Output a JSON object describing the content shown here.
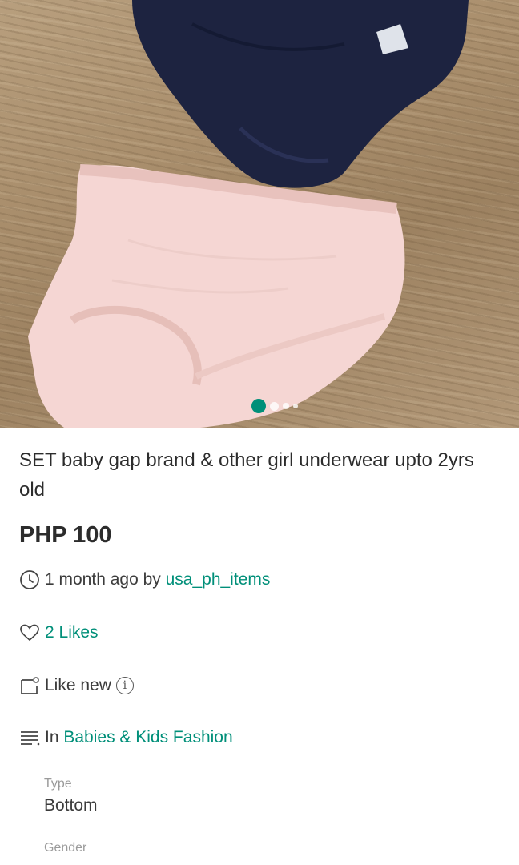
{
  "listing": {
    "title": "SET baby gap brand & other  girl underwear upto 2yrs old",
    "price": "PHP 100",
    "posted_time": "1 month ago by ",
    "seller": "usa_ph_items",
    "likes": "2 Likes",
    "condition": "Like new",
    "category_prefix": "In ",
    "category": "Babies & Kids Fashion"
  },
  "attributes": [
    {
      "label": "Type",
      "value": "Bottom"
    },
    {
      "label": "Gender",
      "value": ""
    }
  ],
  "carousel": {
    "image_count": 4,
    "current_index": 1
  },
  "icons": {
    "time": "clock-icon",
    "likes": "heart-icon",
    "condition": "tag-icon",
    "info": "info-icon",
    "category": "list-icon"
  },
  "colors": {
    "accent": "#008f79",
    "text": "#2c2c2c",
    "muted": "#9a9a9a"
  }
}
